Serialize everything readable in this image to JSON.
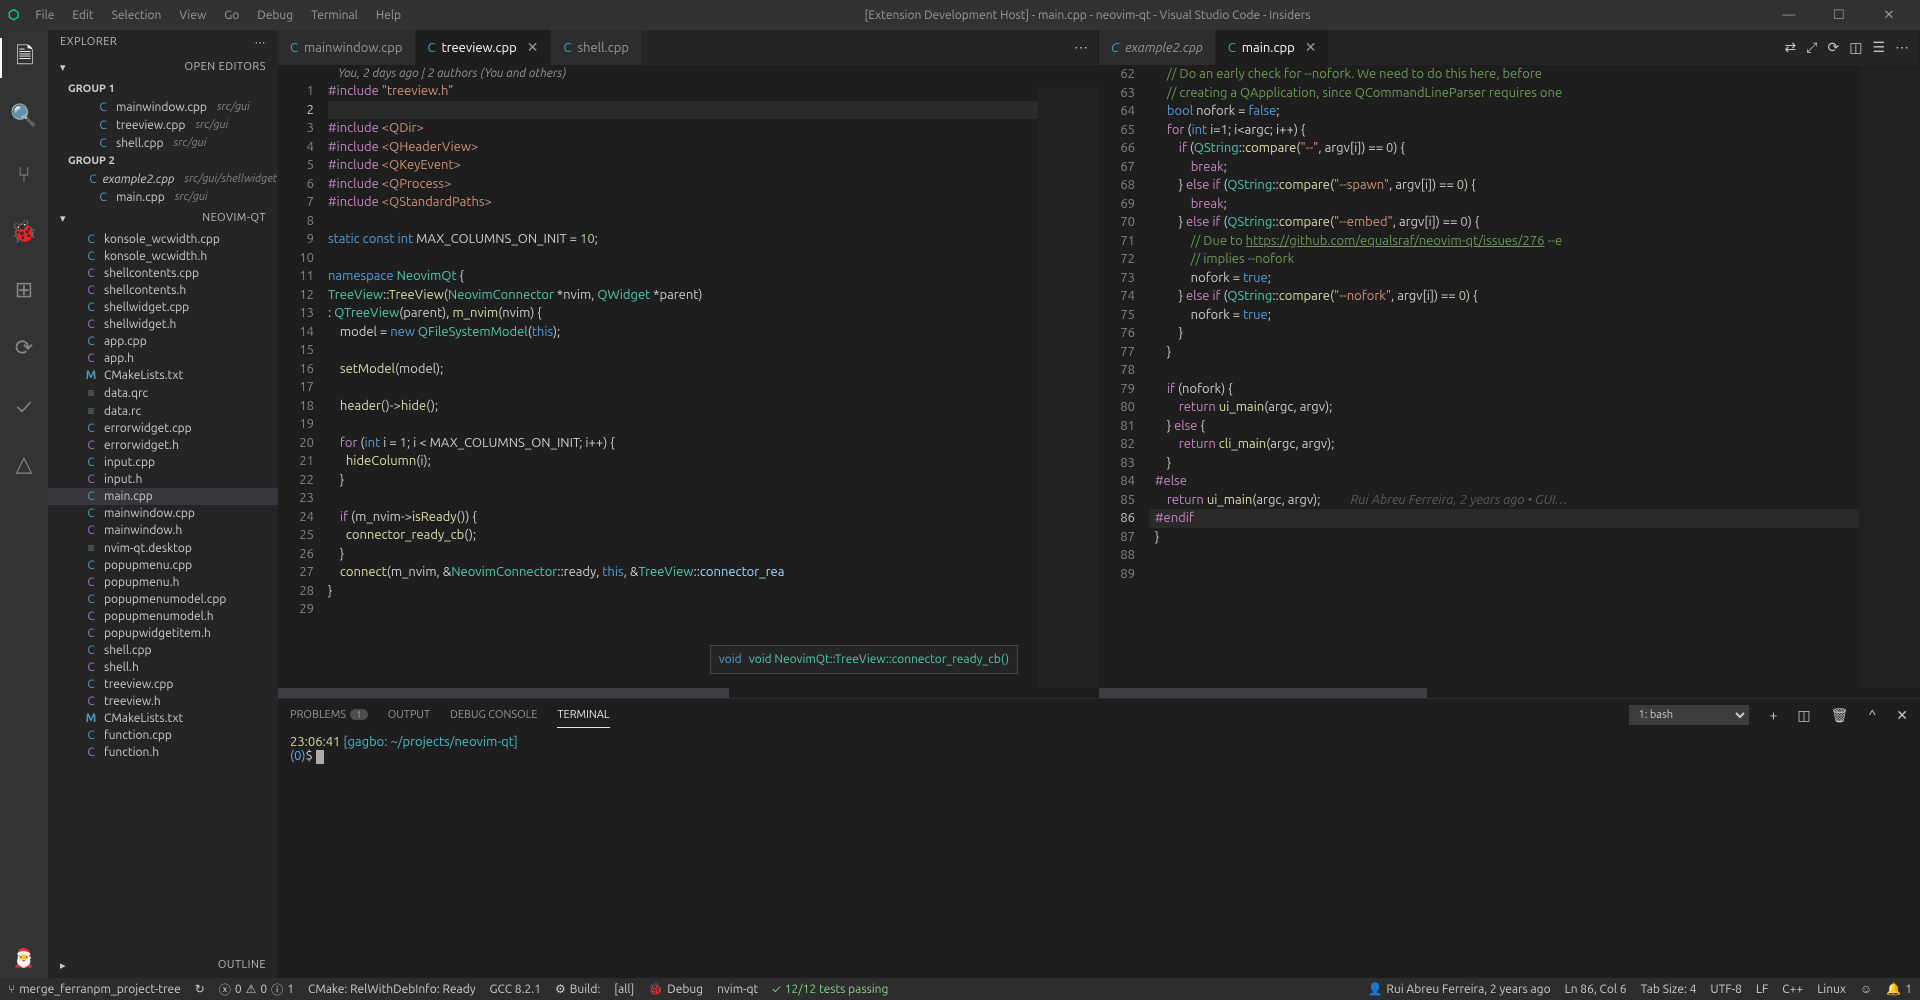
{
  "window_title": "[Extension Development Host] - main.cpp - neovim-qt - Visual Studio Code - Insiders",
  "menus": [
    "File",
    "Edit",
    "Selection",
    "View",
    "Go",
    "Debug",
    "Terminal",
    "Help"
  ],
  "explorer": {
    "title": "EXPLORER",
    "open_editors_label": "OPEN EDITORS",
    "group1": "GROUP 1",
    "group2": "GROUP 2",
    "group1_items": [
      {
        "name": "mainwindow.cpp",
        "hint": "src/gui",
        "icon": "C"
      },
      {
        "name": "treeview.cpp",
        "hint": "src/gui",
        "icon": "C"
      },
      {
        "name": "shell.cpp",
        "hint": "src/gui",
        "icon": "C"
      }
    ],
    "group2_items": [
      {
        "name": "example2.cpp",
        "hint": "src/gui/shellwidget",
        "icon": "C",
        "italic": true
      },
      {
        "name": "main.cpp",
        "hint": "src/gui",
        "icon": "C",
        "close": true
      }
    ],
    "project_name": "NEOVIM-QT",
    "tree": [
      {
        "n": "konsole_wcwidth.cpp",
        "i": "C"
      },
      {
        "n": "konsole_wcwidth.h",
        "i": "C"
      },
      {
        "n": "shellcontents.cpp",
        "i": "C",
        "c": "h"
      },
      {
        "n": "shellcontents.h",
        "i": "C",
        "c": "h"
      },
      {
        "n": "shellwidget.cpp",
        "i": "C"
      },
      {
        "n": "shellwidget.h",
        "i": "C",
        "c": "h"
      },
      {
        "n": "app.cpp",
        "i": "C"
      },
      {
        "n": "app.h",
        "i": "C",
        "c": "h"
      },
      {
        "n": "CMakeLists.txt",
        "i": "M"
      },
      {
        "n": "data.qrc",
        "i": "≡"
      },
      {
        "n": "data.rc",
        "i": "≡"
      },
      {
        "n": "errorwidget.cpp",
        "i": "C"
      },
      {
        "n": "errorwidget.h",
        "i": "C",
        "c": "h"
      },
      {
        "n": "input.cpp",
        "i": "C"
      },
      {
        "n": "input.h",
        "i": "C",
        "c": "h"
      },
      {
        "n": "main.cpp",
        "i": "C",
        "sel": true
      },
      {
        "n": "mainwindow.cpp",
        "i": "C"
      },
      {
        "n": "mainwindow.h",
        "i": "C",
        "c": "h"
      },
      {
        "n": "nvim-qt.desktop",
        "i": "≡"
      },
      {
        "n": "popupmenu.cpp",
        "i": "C"
      },
      {
        "n": "popupmenu.h",
        "i": "C",
        "c": "h"
      },
      {
        "n": "popupmenumodel.cpp",
        "i": "C"
      },
      {
        "n": "popupmenumodel.h",
        "i": "C",
        "c": "h"
      },
      {
        "n": "popupwidgetitem.h",
        "i": "C",
        "c": "h"
      },
      {
        "n": "shell.cpp",
        "i": "C"
      },
      {
        "n": "shell.h",
        "i": "C",
        "c": "h"
      },
      {
        "n": "treeview.cpp",
        "i": "C"
      },
      {
        "n": "treeview.h",
        "i": "C",
        "c": "h"
      },
      {
        "n": "CMakeLists.txt",
        "i": "M"
      },
      {
        "n": "function.cpp",
        "i": "C"
      },
      {
        "n": "function.h",
        "i": "C",
        "c": "h"
      }
    ],
    "outline": "OUTLINE"
  },
  "left_tabs": [
    {
      "name": "mainwindow.cpp"
    },
    {
      "name": "treeview.cpp",
      "active": true
    },
    {
      "name": "shell.cpp"
    }
  ],
  "right_tabs": [
    {
      "name": "example2.cpp",
      "italic": true
    },
    {
      "name": "main.cpp",
      "active": true
    }
  ],
  "annot_left": "You, 2 days ago | 2 authors (You and others)",
  "hover_hint": "void NeovimQt::TreeView::connector_ready_cb()",
  "left_line_start": 1,
  "right_line_start": 62,
  "right_hl_line": 86,
  "right_blame": "Rui Abreu Ferreira, 2 years ago • GUI…",
  "panel": {
    "tabs": [
      "PROBLEMS",
      "OUTPUT",
      "DEBUG CONSOLE",
      "TERMINAL"
    ],
    "problems_count": "1",
    "term_select": "1: bash",
    "term_time": "23:06:41",
    "term_loc": "[gagbo: ~/projects/neovim-qt]",
    "term_status": "(0)",
    "term_prompt": "$"
  },
  "status": {
    "branch": "merge_ferranpm_project-tree",
    "sync": "↻",
    "errors": "0",
    "warnings": "0",
    "hints": "1",
    "cmake": "CMake: RelWithDebInfo: Ready",
    "gcc": "GCC 8.2.1",
    "build": "Build:",
    "target": "[all]",
    "debug": "Debug",
    "exe": "nvim-qt",
    "tests": "12/12 tests passing",
    "author": "Rui Abreu Ferreira, 2 years ago",
    "pos": "Ln 86, Col 6",
    "tab": "Tab Size: 4",
    "enc": "UTF-8",
    "eol": "LF",
    "lang": "C++",
    "os": "Linux",
    "bell": "1"
  }
}
